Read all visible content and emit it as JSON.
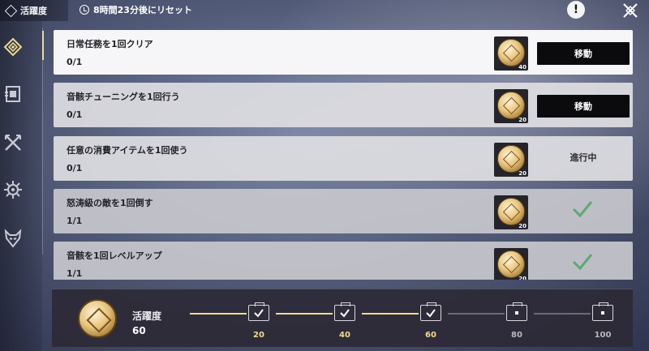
{
  "header": {
    "title": "活躍度",
    "reset_text": "8時間23分後にリセット",
    "help_label": "!"
  },
  "sidebar": {
    "items": [
      {
        "icon": "activity-diamond-icon",
        "active": true
      },
      {
        "icon": "notice-board-icon",
        "active": false
      },
      {
        "icon": "crossed-swords-icon",
        "active": false
      },
      {
        "icon": "gear-burst-icon",
        "active": false
      },
      {
        "icon": "demon-mask-icon",
        "active": false
      }
    ]
  },
  "tasks": [
    {
      "name": "日常任務を1回クリア",
      "progress": "0/1",
      "reward_qty": "40",
      "state": "goto",
      "action_label": "移動"
    },
    {
      "name": "音骸チューニングを1回行う",
      "progress": "0/1",
      "reward_qty": "20",
      "state": "goto",
      "action_label": "移動"
    },
    {
      "name": "任意の消費アイテムを1回使う",
      "progress": "0/1",
      "reward_qty": "20",
      "state": "in_progress",
      "action_label": "進行中"
    },
    {
      "name": "怒涛級の敵を1回倒す",
      "progress": "1/1",
      "reward_qty": "20",
      "state": "done",
      "action_label": ""
    },
    {
      "name": "音骸を1回レベルアップ",
      "progress": "1/1",
      "reward_qty": "20",
      "state": "done",
      "action_label": ""
    }
  ],
  "activity": {
    "label": "活躍度",
    "value": "60",
    "milestones": [
      {
        "label": "20",
        "claimed": true
      },
      {
        "label": "40",
        "claimed": true
      },
      {
        "label": "60",
        "claimed": true
      },
      {
        "label": "80",
        "claimed": false
      },
      {
        "label": "100",
        "claimed": false
      }
    ]
  },
  "colors": {
    "accent_gold": "#f0dc8c",
    "check_green": "#5fa870",
    "inactive_gray": "#b8b8c0"
  }
}
